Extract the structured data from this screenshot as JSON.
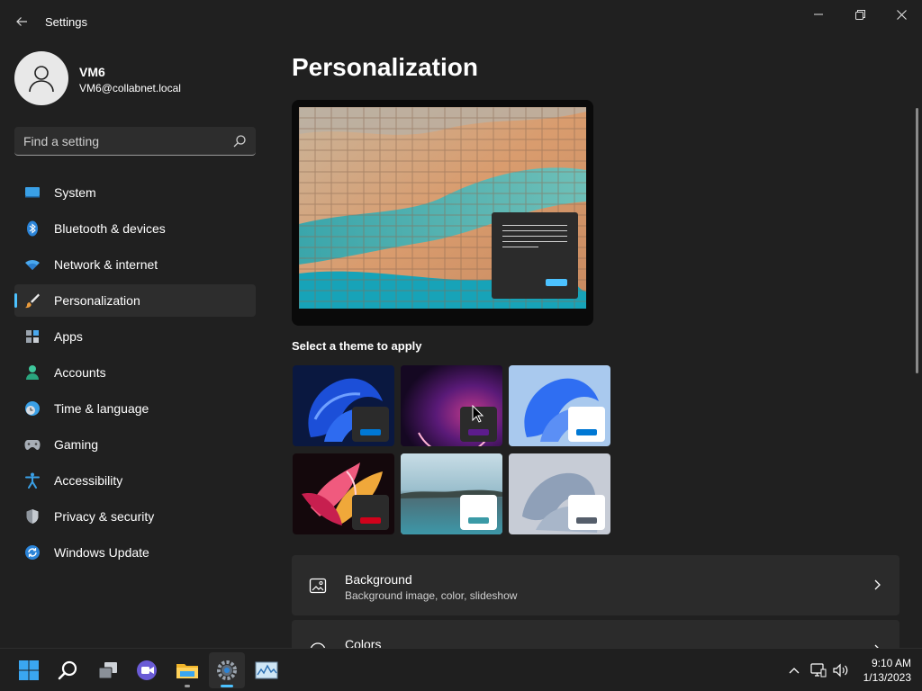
{
  "window": {
    "title": "Settings"
  },
  "user": {
    "name": "VM6",
    "email": "VM6@collabnet.local"
  },
  "search": {
    "placeholder": "Find a setting"
  },
  "sidebar": {
    "items": [
      {
        "label": "System",
        "icon": "monitor-icon"
      },
      {
        "label": "Bluetooth & devices",
        "icon": "bluetooth-icon"
      },
      {
        "label": "Network & internet",
        "icon": "wifi-icon"
      },
      {
        "label": "Personalization",
        "icon": "paintbrush-icon",
        "active": true
      },
      {
        "label": "Apps",
        "icon": "apps-icon"
      },
      {
        "label": "Accounts",
        "icon": "person-icon"
      },
      {
        "label": "Time & language",
        "icon": "globe-clock-icon"
      },
      {
        "label": "Gaming",
        "icon": "gamepad-icon"
      },
      {
        "label": "Accessibility",
        "icon": "accessibility-icon"
      },
      {
        "label": "Privacy & security",
        "icon": "shield-icon"
      },
      {
        "label": "Windows Update",
        "icon": "update-icon"
      }
    ]
  },
  "main": {
    "title": "Personalization",
    "themes_label": "Select a theme to apply",
    "themes": [
      {
        "name": "windows-dark-bloom",
        "accent": "#0078d4"
      },
      {
        "name": "glow",
        "accent": "#5c1c8c"
      },
      {
        "name": "windows-light-bloom",
        "accent": "#0078d4"
      },
      {
        "name": "captured-motion",
        "accent": "#d0021b"
      },
      {
        "name": "sunrise-lake",
        "accent": "#3a9aa6"
      },
      {
        "name": "flow",
        "accent": "#555e6b"
      }
    ],
    "cards": [
      {
        "title": "Background",
        "subtitle": "Background image, color, slideshow",
        "icon": "image-icon"
      },
      {
        "title": "Colors",
        "subtitle": "",
        "icon": "palette-icon"
      }
    ]
  },
  "taskbar": {
    "apps": [
      "start-icon",
      "search-icon",
      "task-view-icon",
      "teams-chat-icon",
      "file-explorer-icon",
      "settings-icon",
      "resource-monitor-icon"
    ],
    "time": "9:10 AM",
    "date": "1/13/2023"
  },
  "colors": {
    "accent": "#4cc2ff",
    "background": "#202020",
    "card": "#2b2b2b"
  }
}
